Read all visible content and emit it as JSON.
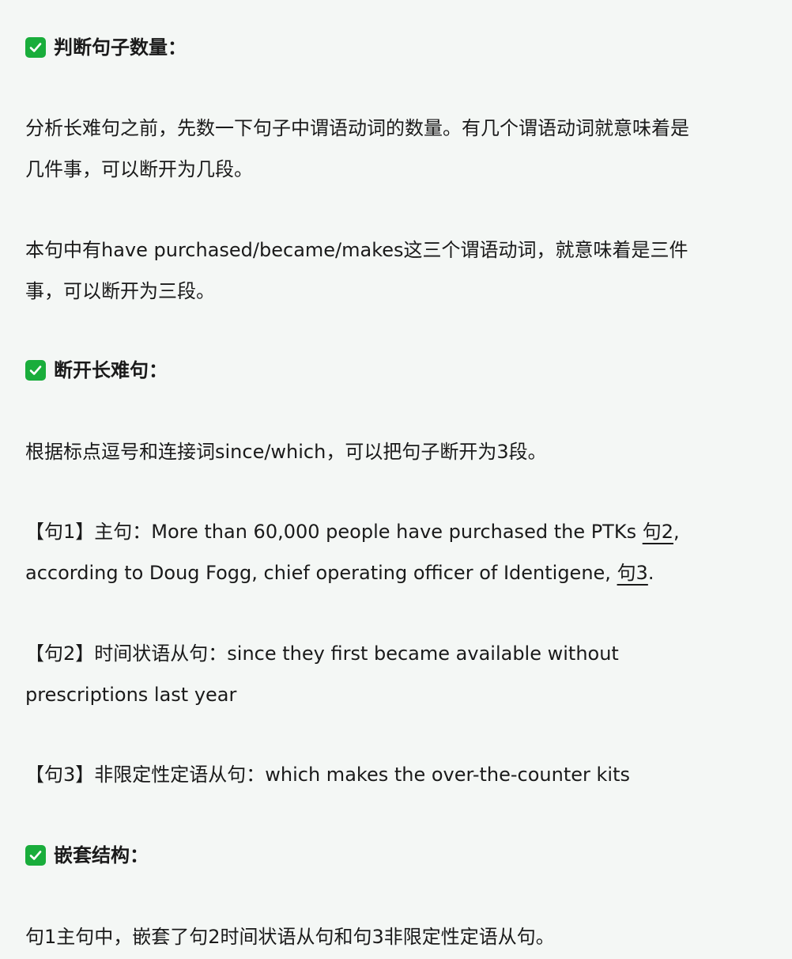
{
  "sections": [
    {
      "heading": "判断句子数量：",
      "paragraphs": [
        [
          "分析长难句之前，先数一下句子中谓语动词的数量。有几个谓语动词就意味着是",
          "几件事，可以断开为几段。"
        ],
        [
          "本句中有have purchased/became/makes这三个谓语动词，就意味着是三件",
          "事，可以断开为三段。"
        ]
      ]
    },
    {
      "heading": "断开长难句：",
      "intro": "根据标点逗号和连接词since/which，可以把句子断开为3段。",
      "sentence1": {
        "line1_prefix": "【句1】主句：More than 60,000 people have purchased the PTKs ",
        "line1_link": "句2",
        "line1_suffix": ",",
        "line2_prefix": "according to Doug Fogg, chief operating officer of Identigene, ",
        "line2_link": "句3",
        "line2_suffix": "."
      },
      "sentence2": [
        "【句2】时间状语从句：since they first became available without",
        "prescriptions last year"
      ],
      "sentence3": "【句3】非限定性定语从句：which makes the over-the-counter kits"
    },
    {
      "heading": "嵌套结构：",
      "paragraph": "句1主句中，嵌套了句2时间状语从句和句3非限定性定语从句。"
    }
  ],
  "icons": {
    "check": "check-mark-icon",
    "check_color": "#19ad3b"
  }
}
